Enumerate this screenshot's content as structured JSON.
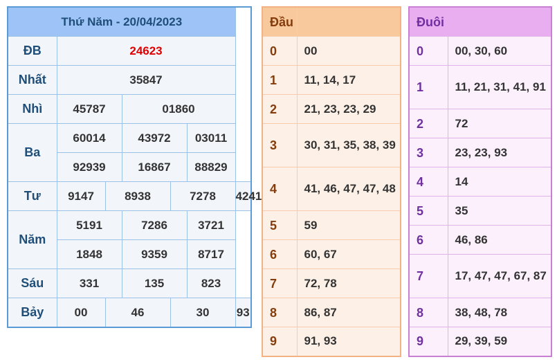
{
  "main": {
    "title": "Thứ Năm - 20/04/2023",
    "db_label": "ĐB",
    "db": "24623",
    "nhat_label": "Nhất",
    "nhat": "35847",
    "nhi_label": "Nhì",
    "nhi": [
      "45787",
      "01860"
    ],
    "ba_label": "Ba",
    "ba": [
      "60014",
      "43972",
      "03011",
      "92939",
      "16867",
      "88829"
    ],
    "tu_label": "Tư",
    "tu": [
      "9147",
      "8938",
      "7278",
      "4241"
    ],
    "nam_label": "Năm",
    "nam": [
      "5191",
      "7286",
      "3721",
      "1848",
      "9359",
      "8717"
    ],
    "sau_label": "Sáu",
    "sau": [
      "331",
      "135",
      "823"
    ],
    "bay_label": "Bảy",
    "bay": [
      "00",
      "46",
      "30",
      "93"
    ]
  },
  "dau": {
    "header": "Đầu",
    "rows": [
      {
        "k": "0",
        "v": "00"
      },
      {
        "k": "1",
        "v": "11, 14, 17"
      },
      {
        "k": "2",
        "v": "21, 23, 23, 29"
      },
      {
        "k": "3",
        "v": "30, 31, 35, 38, 39"
      },
      {
        "k": "4",
        "v": "41, 46, 47, 47, 48"
      },
      {
        "k": "5",
        "v": "59"
      },
      {
        "k": "6",
        "v": "60, 67"
      },
      {
        "k": "7",
        "v": "72, 78"
      },
      {
        "k": "8",
        "v": "86, 87"
      },
      {
        "k": "9",
        "v": "91, 93"
      }
    ]
  },
  "duoi": {
    "header": "Đuôi",
    "rows": [
      {
        "k": "0",
        "v": "00, 30, 60"
      },
      {
        "k": "1",
        "v": "11, 21, 31, 41, 91"
      },
      {
        "k": "2",
        "v": "72"
      },
      {
        "k": "3",
        "v": "23, 23, 93"
      },
      {
        "k": "4",
        "v": "14"
      },
      {
        "k": "5",
        "v": "35"
      },
      {
        "k": "6",
        "v": "46, 86"
      },
      {
        "k": "7",
        "v": "17, 47, 47, 67, 87"
      },
      {
        "k": "8",
        "v": "38, 48, 78"
      },
      {
        "k": "9",
        "v": "29, 39, 59"
      }
    ]
  }
}
